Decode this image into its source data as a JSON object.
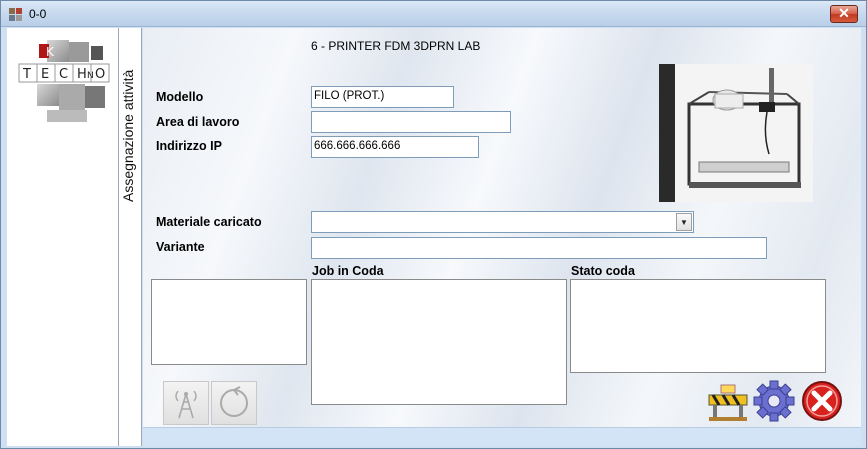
{
  "window": {
    "title": "0-0",
    "close_label": "✕"
  },
  "side_tab": {
    "label": "Assegnazione attività"
  },
  "device": {
    "title": "6 - PRINTER FDM 3DPRN LAB"
  },
  "form": {
    "modello": {
      "label": "Modello",
      "value": "FILO (PROT.)"
    },
    "area_lavoro": {
      "label": "Area di lavoro",
      "value": ""
    },
    "indirizzo_ip": {
      "label": "Indirizzo IP",
      "value": "666.666.666.666"
    },
    "materiale": {
      "label": "Materiale caricato",
      "value": ""
    },
    "variante": {
      "label": "Variante",
      "value": ""
    }
  },
  "lists": {
    "job_in_coda": {
      "label": "Job in Coda"
    },
    "stato_coda": {
      "label": "Stato coda"
    }
  },
  "logo": {
    "letters": [
      "T",
      "E",
      "C",
      "H",
      "N",
      "O"
    ],
    "accent_letter": "K"
  },
  "icons": {
    "app": "app-icon",
    "antenna": "antenna-icon",
    "refresh": "refresh-icon",
    "construction": "construction-barrier-icon",
    "settings": "gear-icon",
    "cancel": "cancel-icon"
  },
  "colors": {
    "close": "#c2391f",
    "gear": "#6a6fd0",
    "cancel": "#d8221e",
    "barrier": "#f0c020"
  }
}
